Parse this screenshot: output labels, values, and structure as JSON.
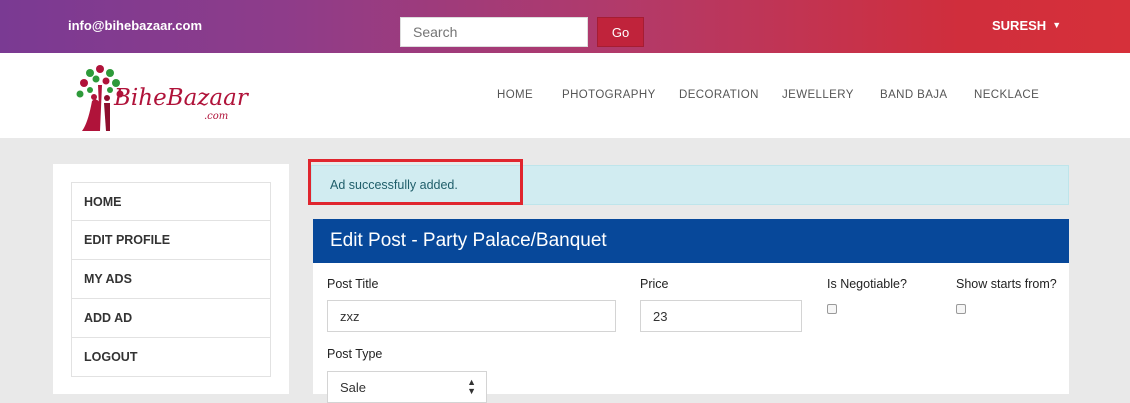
{
  "topbar": {
    "email": "info@bihebazaar.com",
    "search_placeholder": "Search",
    "go_label": "Go",
    "user_label": "SURESH",
    "caret": "▼"
  },
  "logo": {
    "script_text": "BiheBazaar",
    "suffix": ".com"
  },
  "nav": [
    "HOME",
    "PHOTOGRAPHY",
    "DECORATION",
    "JEWELLERY",
    "BAND BAJA",
    "NECKLACE"
  ],
  "sidebar": [
    "HOME",
    "EDIT PROFILE",
    "MY ADS",
    "ADD AD",
    "LOGOUT"
  ],
  "alert": {
    "message": "Ad successfully added."
  },
  "form": {
    "title": "Edit Post - Party Palace/Banquet",
    "post_title_label": "Post Title",
    "post_title_value": "zxz",
    "price_label": "Price",
    "price_value": "23",
    "negotiable_label": "Is Negotiable?",
    "show_starts_label": "Show starts from?",
    "post_type_label": "Post Type",
    "post_type_value": "Sale"
  },
  "colors": {
    "topbar_start": "#7a3a93",
    "topbar_end": "#d6303a",
    "card_header": "#07489a",
    "alert_bg": "#d1ecf1",
    "highlight": "#e0252e"
  }
}
